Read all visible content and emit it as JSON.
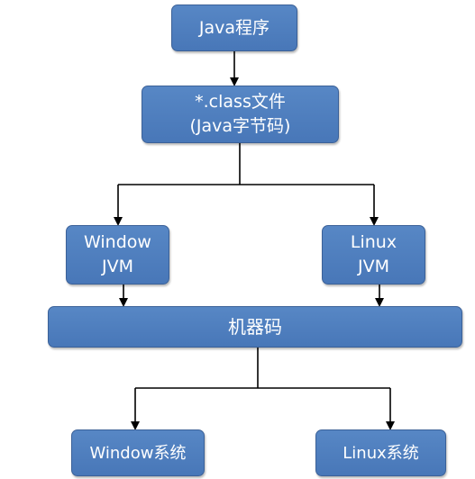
{
  "nodes": {
    "java_program": "Java程序",
    "class_file": {
      "line1": "*.class文件",
      "line2": "(Java字节码)"
    },
    "window_jvm": {
      "line1": "Window",
      "line2": "JVM"
    },
    "linux_jvm": {
      "line1": "Linux",
      "line2": "JVM"
    },
    "machine_code": "机器码",
    "window_system": "Window系统",
    "linux_system": "Linux系统"
  },
  "colors": {
    "box_fill": "#4f81bd",
    "box_border": "#3b6198",
    "text": "#ffffff",
    "connector": "#000000"
  }
}
